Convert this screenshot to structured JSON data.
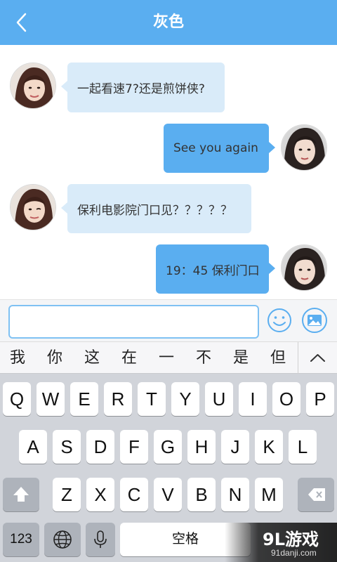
{
  "header": {
    "title": "灰色"
  },
  "messages": [
    {
      "side": "left",
      "text": "一起看速7?还是煎饼侠?"
    },
    {
      "side": "right",
      "text": "See you again"
    },
    {
      "side": "left",
      "text": "保利电影院门口见？？？？？"
    },
    {
      "side": "right",
      "text": "19：45 保利门口"
    }
  ],
  "input": {
    "value": "",
    "placeholder": ""
  },
  "suggestions": [
    "我",
    "你",
    "这",
    "在",
    "一",
    "不",
    "是",
    "但"
  ],
  "keyboard": {
    "row1": [
      "Q",
      "W",
      "E",
      "R",
      "T",
      "Y",
      "U",
      "I",
      "O",
      "P"
    ],
    "row2": [
      "A",
      "S",
      "D",
      "F",
      "G",
      "H",
      "J",
      "K",
      "L"
    ],
    "row3": [
      "Z",
      "X",
      "C",
      "V",
      "B",
      "N",
      "M"
    ],
    "numbers_key": "123",
    "space_key": "空格"
  },
  "watermark": {
    "brand": "9L游戏",
    "url": "91danji.com"
  },
  "colors": {
    "header": "#5aaef0",
    "bubble_left": "#d9ebf9",
    "bubble_right": "#5aaef0",
    "keyboard_bg": "#d1d4da"
  }
}
